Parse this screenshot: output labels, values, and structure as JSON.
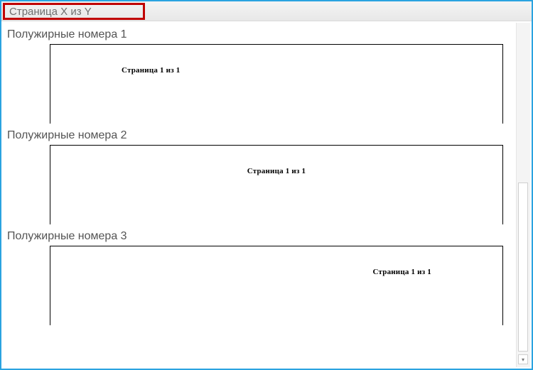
{
  "header": {
    "label": "Страница X из Y"
  },
  "sections": [
    {
      "title": "Полужирные номера 1",
      "sample": "Страница 1 из 1"
    },
    {
      "title": "Полужирные номера 2",
      "sample": "Страница 1 из 1"
    },
    {
      "title": "Полужирные номера 3",
      "sample": "Страница 1 из 1"
    }
  ],
  "icons": {
    "down": "▾"
  }
}
